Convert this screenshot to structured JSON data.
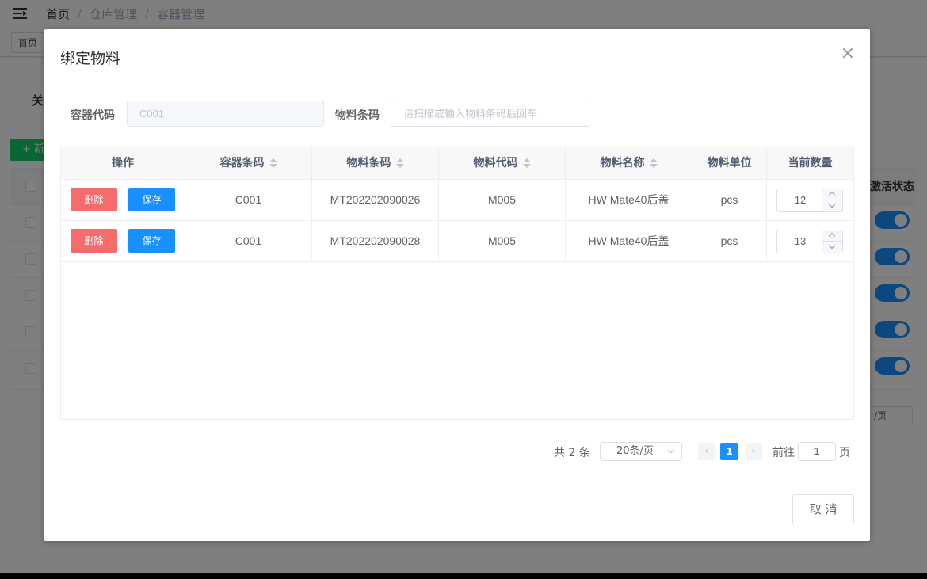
{
  "breadcrumb": {
    "items": [
      "首页",
      "仓库管理",
      "容器管理"
    ],
    "separator": "/"
  },
  "tags": {
    "home": "首页"
  },
  "background": {
    "title_fragment": "关",
    "add_button": "+ 新",
    "active_status_header": "激活状态",
    "pager_fragment": "/页"
  },
  "dialog": {
    "title": "绑定物料",
    "close_icon": "close-icon",
    "form": {
      "container_code_label": "容器代码",
      "container_code_value": "C001",
      "material_barcode_label": "物料条码",
      "material_barcode_placeholder": "请扫描或输入物料条码后回车"
    },
    "table": {
      "columns": [
        "操作",
        "容器条码",
        "物料条码",
        "物料代码",
        "物料名称",
        "物料单位",
        "当前数量"
      ],
      "delete_label": "删除",
      "save_label": "保存",
      "rows": [
        {
          "container": "C001",
          "barcode": "MT202202090026",
          "code": "M005",
          "name": "HW Mate40后盖",
          "unit": "pcs",
          "qty": "12"
        },
        {
          "container": "C001",
          "barcode": "MT202202090028",
          "code": "M005",
          "name": "HW Mate40后盖",
          "unit": "pcs",
          "qty": "13"
        }
      ]
    },
    "pagination": {
      "total": "共 2 条",
      "page_size": "20条/页",
      "current_page": "1",
      "goto_label": "前往",
      "goto_value": "1",
      "page_unit": "页"
    },
    "cancel_label": "取 消"
  },
  "colors": {
    "primary": "#1890ff",
    "danger": "#f56c6c",
    "success": "#13ce66"
  }
}
